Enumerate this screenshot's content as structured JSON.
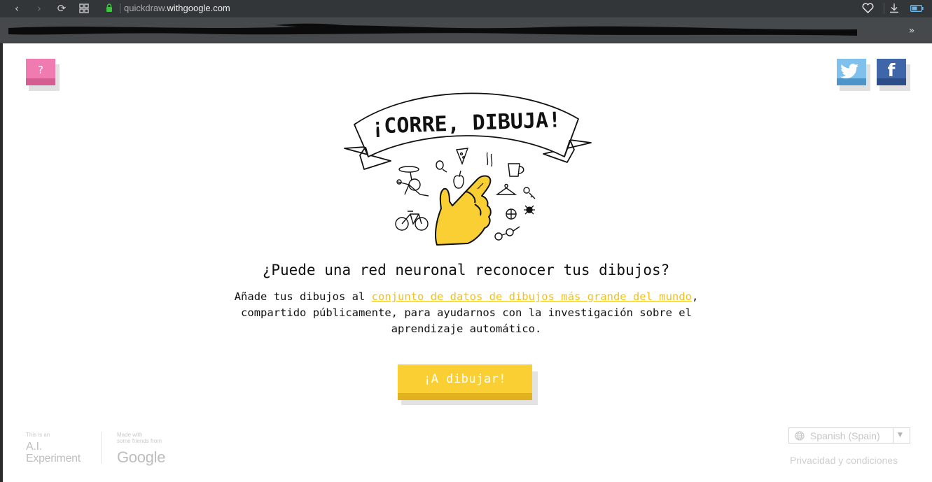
{
  "browser": {
    "url_prefix": "quickdraw.",
    "url_domain": "withgoogle.com",
    "back_icon": "‹",
    "forward_icon": "›",
    "reload_icon": "⟳",
    "overflow_icon": "»",
    "accent_secure": "#3ec53e"
  },
  "header": {
    "help_label": "?"
  },
  "hero": {
    "banner_text": "¡CORRE, DIBUJA!"
  },
  "main": {
    "headline": "¿Puede una red neuronal reconocer tus dibujos?",
    "intro_before": "Añade tus dibujos al ",
    "intro_link": "conjunto de datos de dibujos más grande del mundo",
    "intro_after": ", compartido públicamente, para ayudarnos con la investigación sobre el aprendizaje automático.",
    "draw_button": "¡A dibujar!"
  },
  "footer": {
    "ai_small": "This is an",
    "ai_line1": "A.I.",
    "ai_line2": "Experiment",
    "made_line1": "Made with",
    "made_line2": "some friends from",
    "google": "Google",
    "language": "Spanish (Spain)",
    "privacy": "Privacidad y condiciones"
  },
  "colors": {
    "yellow": "#f9cf33",
    "link_yellow": "#f2c21b",
    "pink": "#f07bb0",
    "twitter": "#7fc1ec",
    "facebook": "#3f66a8"
  }
}
